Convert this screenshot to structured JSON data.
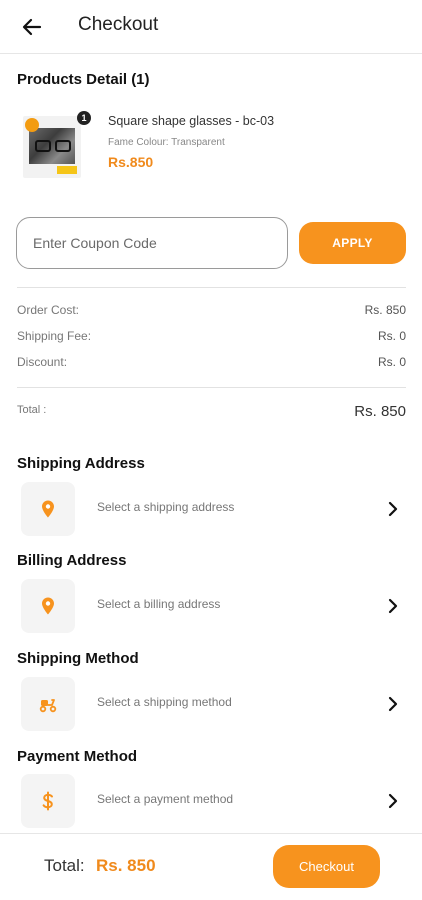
{
  "header": {
    "title": "Checkout",
    "back_icon": "arrow-left-icon"
  },
  "products": {
    "section_title": "Products Detail (1)",
    "items": [
      {
        "name": "Square shape glasses  - bc-03",
        "attribute": "Fame Colour: Transparent",
        "price": "Rs.850",
        "quantity": "1"
      }
    ]
  },
  "coupon": {
    "placeholder": "Enter Coupon Code",
    "value": "",
    "apply_label": "APPLY"
  },
  "summary": {
    "rows": [
      {
        "label": "Order Cost:",
        "value": "Rs. 850"
      },
      {
        "label": "Shipping Fee:",
        "value": "Rs. 0"
      },
      {
        "label": "Discount:",
        "value": "Rs. 0"
      }
    ],
    "total_label": "Total :",
    "total_value": "Rs. 850"
  },
  "shipping_address": {
    "title": "Shipping Address",
    "placeholder": "Select a shipping address",
    "icon": "location-pin-icon"
  },
  "billing_address": {
    "title": "Billing Address",
    "placeholder": "Select a billing address",
    "icon": "location-pin-icon"
  },
  "shipping_method": {
    "title": "Shipping Method",
    "placeholder": "Select a shipping method",
    "icon": "scooter-icon"
  },
  "payment_method": {
    "title": "Payment Method",
    "placeholder": "Select a payment method",
    "icon": "dollar-icon"
  },
  "footer": {
    "total_label": "Total:",
    "total_value": "Rs. 850",
    "checkout_label": "Checkout"
  },
  "colors": {
    "accent": "#f7931e",
    "price": "#f08a1c",
    "icon_bg": "#f4f4f4"
  }
}
